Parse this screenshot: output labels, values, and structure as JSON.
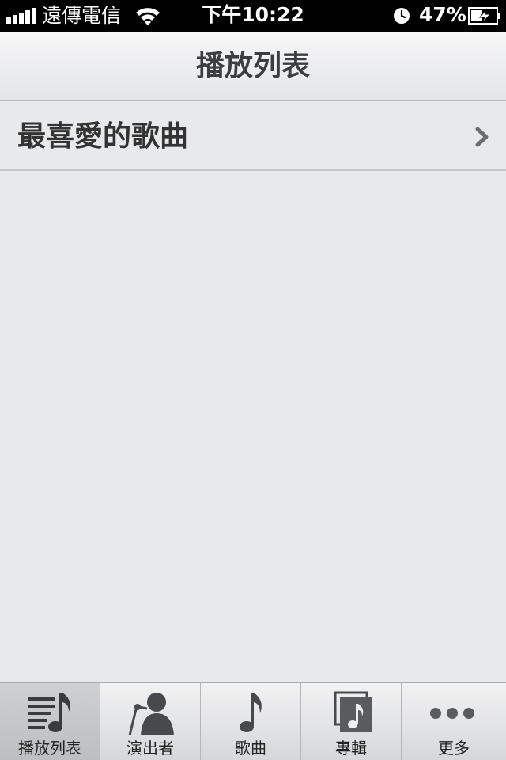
{
  "status_bar": {
    "carrier": "遠傳電信",
    "time": "下午10:22",
    "battery_percent": "47%",
    "icons": [
      "signal-bars-icon",
      "wifi-icon",
      "alarm-clock-icon",
      "battery-charging-icon"
    ]
  },
  "nav": {
    "title": "播放列表"
  },
  "list": {
    "items": [
      {
        "label": "最喜愛的歌曲",
        "icon": "chevron-right-icon"
      }
    ]
  },
  "tab_bar": {
    "selected_index": 0,
    "tabs": [
      {
        "label": "播放列表",
        "icon": "playlist-icon"
      },
      {
        "label": "演出者",
        "icon": "artist-icon"
      },
      {
        "label": "歌曲",
        "icon": "music-note-icon"
      },
      {
        "label": "專輯",
        "icon": "album-icon"
      },
      {
        "label": "更多",
        "icon": "more-dots-icon"
      }
    ]
  },
  "colors": {
    "background": "#e8e9eb",
    "status_bar": "#000000",
    "text": "#333333",
    "tab_selected": "#c6c7c9"
  }
}
